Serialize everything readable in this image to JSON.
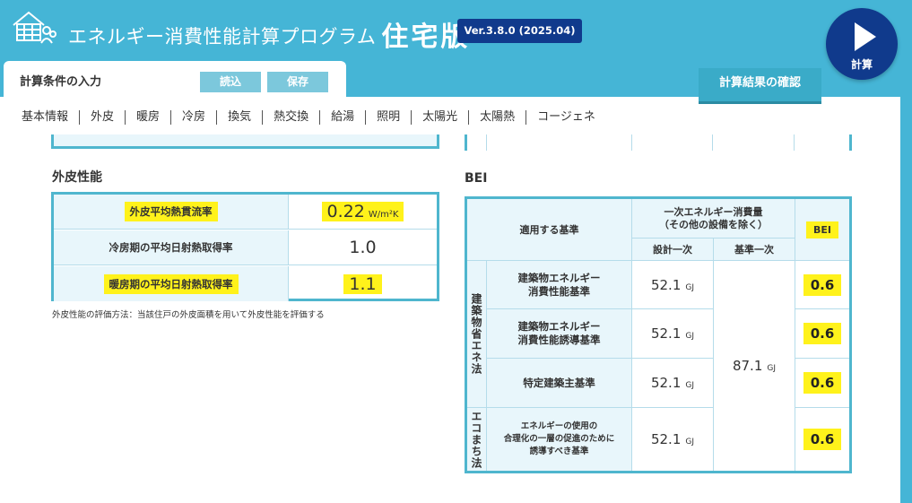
{
  "header": {
    "title": "エネルギー消費性能計算プログラム",
    "edition": "住宅版",
    "version": "Ver.3.8.0 (2025.04)",
    "calc_label": "計算"
  },
  "tabs": {
    "input_label": "計算条件の入力",
    "load_label": "読込",
    "save_label": "保存",
    "results_label": "計算結果の確認"
  },
  "nav": [
    "基本情報",
    "外皮",
    "暖房",
    "冷房",
    "換気",
    "熱交換",
    "給湯",
    "照明",
    "太陽光",
    "太陽熱",
    "コージェネ"
  ],
  "envelope": {
    "heading": "外皮性能",
    "rows": [
      {
        "label": "外皮平均熱貫流率",
        "value": "0.22",
        "unit": "W/m²K"
      },
      {
        "label": "冷房期の平均日射熱取得率",
        "value": "1.0",
        "unit": ""
      },
      {
        "label": "暖房期の平均日射熱取得率",
        "value": "1.1",
        "unit": ""
      }
    ],
    "note": "外皮性能の評価方法：当該住戸の外皮面積を用いて外皮性能を評価する"
  },
  "bei": {
    "heading": "BEI",
    "col_standard": "適用する基準",
    "col_primary": "一次エネルギー消費量\n（その他の設備を除く）",
    "col_design": "設計一次",
    "col_base": "基準一次",
    "col_bei": "BEI",
    "law_building": "建築物省エネ法",
    "law_eco": "エコまち法",
    "unit": "GJ",
    "base_value": "87.1",
    "rows": [
      {
        "standard": "建築物エネルギー\n消費性能基準",
        "design": "52.1",
        "bei": "0.6"
      },
      {
        "standard": "建築物エネルギー\n消費性能誘導基準",
        "design": "52.1",
        "bei": "0.6"
      },
      {
        "standard": "特定建築主基準",
        "design": "52.1",
        "bei": "0.6"
      },
      {
        "standard": "エネルギーの使用の\n合理化の一層の促進のために\n誘導すべき基準",
        "design": "52.1",
        "bei": "0.6"
      }
    ]
  },
  "colors": {
    "header_bg": "#45b5d6",
    "badge_bg": "#103a8c",
    "table_border": "#4fb6ce",
    "highlight": "#fff21b"
  }
}
